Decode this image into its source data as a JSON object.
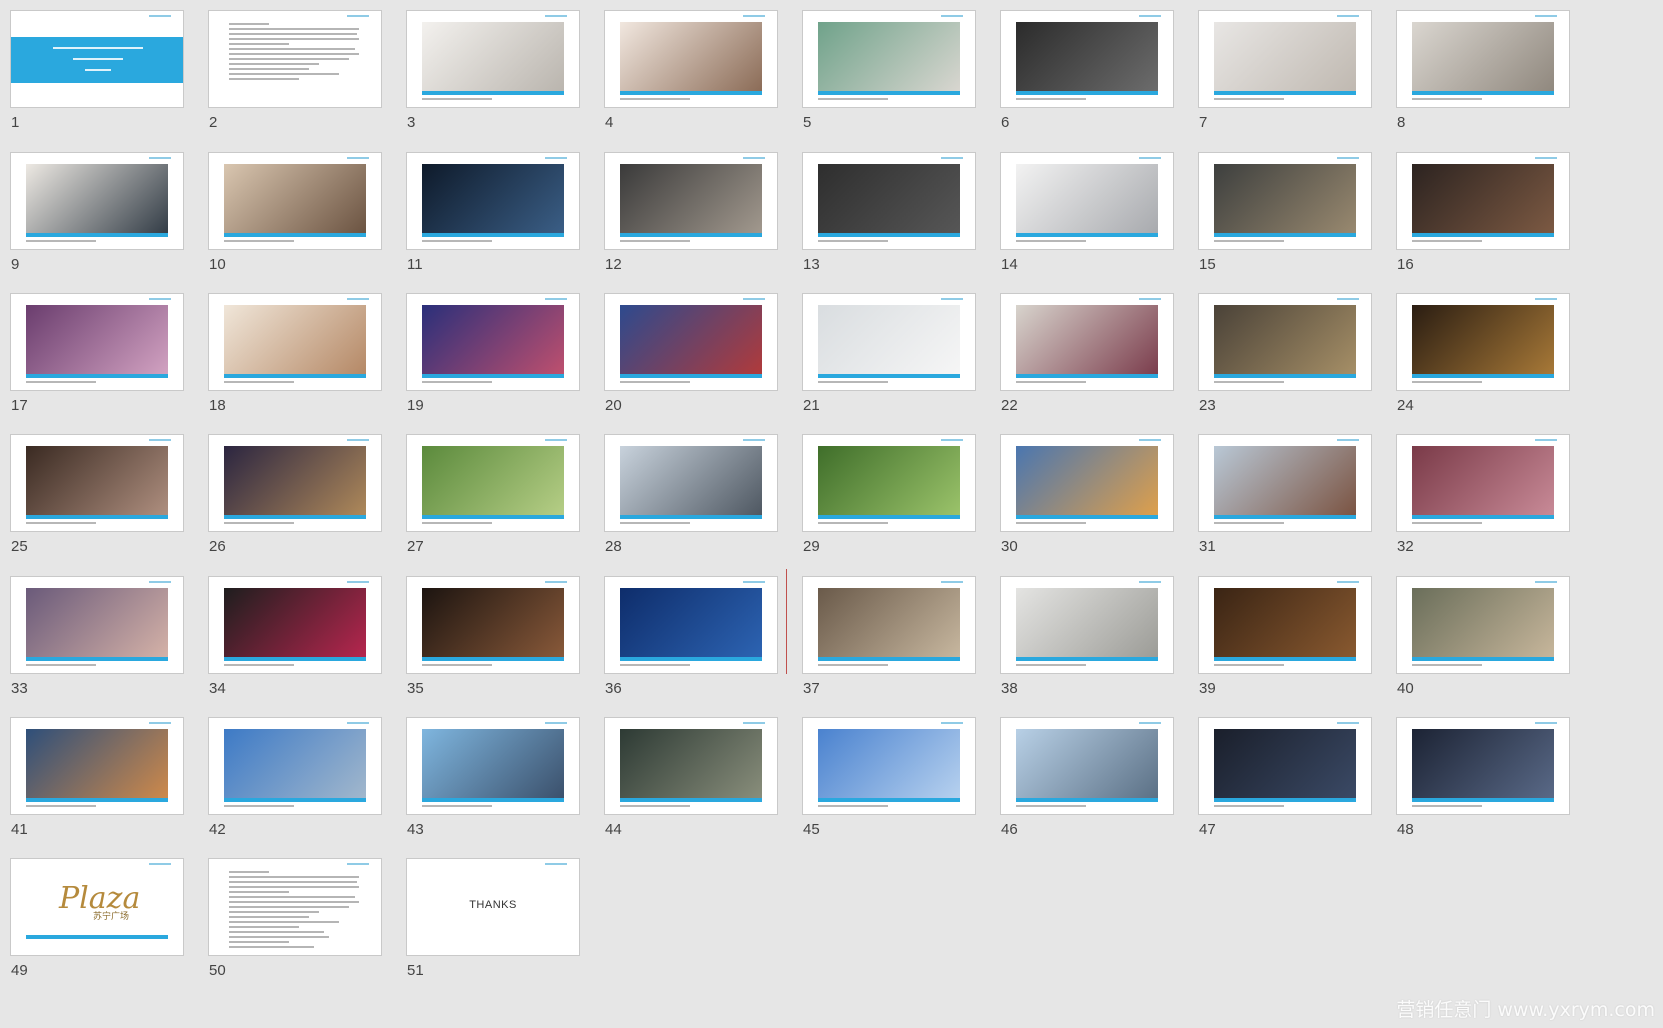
{
  "view": "slide-sorter",
  "slides": [
    {
      "number": "1",
      "kind": "title",
      "photo": [
        "#2aa8de",
        "#2aa8de"
      ]
    },
    {
      "number": "2",
      "kind": "text"
    },
    {
      "number": "3",
      "kind": "photo",
      "photo": [
        "#f3f1ee",
        "#b9b4ad"
      ]
    },
    {
      "number": "4",
      "kind": "photo",
      "photo": [
        "#f1e7df",
        "#8a6a55"
      ]
    },
    {
      "number": "5",
      "kind": "photo",
      "photo": [
        "#6fa28a",
        "#dad7d1"
      ]
    },
    {
      "number": "6",
      "kind": "photo",
      "photo": [
        "#2b2b2b",
        "#6d6d6d"
      ]
    },
    {
      "number": "7",
      "kind": "photo",
      "photo": [
        "#e8e6e4",
        "#bfb8b0"
      ]
    },
    {
      "number": "8",
      "kind": "photo",
      "photo": [
        "#dad6d0",
        "#8f877d"
      ]
    },
    {
      "number": "9",
      "kind": "photo",
      "photo": [
        "#ede9e3",
        "#303a44"
      ]
    },
    {
      "number": "10",
      "kind": "photo",
      "photo": [
        "#d9c6b0",
        "#6a5240"
      ]
    },
    {
      "number": "11",
      "kind": "photo",
      "photo": [
        "#0e1a2a",
        "#3b5f87"
      ]
    },
    {
      "number": "12",
      "kind": "photo",
      "photo": [
        "#3a3a3a",
        "#a39a8f"
      ]
    },
    {
      "number": "13",
      "kind": "photo",
      "photo": [
        "#2e2e2e",
        "#575757"
      ]
    },
    {
      "number": "14",
      "kind": "photo",
      "photo": [
        "#f2f2f2",
        "#a7a9ad"
      ]
    },
    {
      "number": "15",
      "kind": "photo",
      "photo": [
        "#3d3f3e",
        "#9a8a70"
      ]
    },
    {
      "number": "16",
      "kind": "photo",
      "photo": [
        "#2c2320",
        "#7d5a43"
      ]
    },
    {
      "number": "17",
      "kind": "photo",
      "photo": [
        "#6a3d6e",
        "#d3a3c2"
      ]
    },
    {
      "number": "18",
      "kind": "photo",
      "photo": [
        "#f0e6d9",
        "#b48764"
      ]
    },
    {
      "number": "19",
      "kind": "photo",
      "photo": [
        "#2a2f7a",
        "#c0506e"
      ]
    },
    {
      "number": "20",
      "kind": "photo",
      "photo": [
        "#2d4a8e",
        "#b23a3a"
      ]
    },
    {
      "number": "21",
      "kind": "photo",
      "photo": [
        "#d9dde0",
        "#f6f6f6"
      ]
    },
    {
      "number": "22",
      "kind": "photo",
      "photo": [
        "#d8d4cd",
        "#7a3b4b"
      ]
    },
    {
      "number": "23",
      "kind": "photo",
      "photo": [
        "#4a4238",
        "#a79067"
      ]
    },
    {
      "number": "24",
      "kind": "photo",
      "photo": [
        "#2a1d12",
        "#a97a38"
      ]
    },
    {
      "number": "25",
      "kind": "photo",
      "photo": [
        "#3a2a22",
        "#b09080"
      ]
    },
    {
      "number": "26",
      "kind": "photo",
      "photo": [
        "#2b2540",
        "#b08a5a"
      ]
    },
    {
      "number": "27",
      "kind": "photo",
      "photo": [
        "#5b8a3c",
        "#b7cf87"
      ]
    },
    {
      "number": "28",
      "kind": "photo",
      "photo": [
        "#c8d2dc",
        "#4d5660"
      ]
    },
    {
      "number": "29",
      "kind": "photo",
      "photo": [
        "#3f6e2a",
        "#9cc46b"
      ]
    },
    {
      "number": "30",
      "kind": "photo",
      "photo": [
        "#4a76b0",
        "#e0a04a"
      ]
    },
    {
      "number": "31",
      "kind": "photo",
      "photo": [
        "#b9c8d6",
        "#7a5240"
      ]
    },
    {
      "number": "32",
      "kind": "photo",
      "photo": [
        "#7a3a48",
        "#c98b98"
      ]
    },
    {
      "number": "33",
      "kind": "photo",
      "photo": [
        "#6a5a7a",
        "#d6b3a8"
      ]
    },
    {
      "number": "34",
      "kind": "photo",
      "photo": [
        "#1e1e1e",
        "#b8264f"
      ]
    },
    {
      "number": "35",
      "kind": "photo",
      "photo": [
        "#1c1410",
        "#8a5a3a"
      ]
    },
    {
      "number": "36",
      "kind": "photo",
      "photo": [
        "#0e2d6b",
        "#2d64b3"
      ]
    },
    {
      "number": "37",
      "kind": "photo",
      "photo": [
        "#6a5a4a",
        "#c8b8a0"
      ]
    },
    {
      "number": "38",
      "kind": "photo",
      "photo": [
        "#e4e4e2",
        "#9b9b96"
      ]
    },
    {
      "number": "39",
      "kind": "photo",
      "photo": [
        "#3a2414",
        "#8a5a30"
      ]
    },
    {
      "number": "40",
      "kind": "photo",
      "photo": [
        "#6a6e5a",
        "#c8b79c"
      ]
    },
    {
      "number": "41",
      "kind": "photo",
      "photo": [
        "#2e4f7a",
        "#d08a4a"
      ]
    },
    {
      "number": "42",
      "kind": "photo",
      "photo": [
        "#3d7ac6",
        "#a3b8cc"
      ]
    },
    {
      "number": "43",
      "kind": "photo",
      "photo": [
        "#7fb6df",
        "#3a4f6a"
      ]
    },
    {
      "number": "44",
      "kind": "photo",
      "photo": [
        "#2d3a34",
        "#8a8f7c"
      ]
    },
    {
      "number": "45",
      "kind": "photo",
      "photo": [
        "#4a82cf",
        "#b8d2ef"
      ]
    },
    {
      "number": "46",
      "kind": "photo",
      "photo": [
        "#b8d0e6",
        "#5a6f84"
      ]
    },
    {
      "number": "47",
      "kind": "photo",
      "photo": [
        "#1a1f2b",
        "#3b4a66"
      ]
    },
    {
      "number": "48",
      "kind": "photo",
      "photo": [
        "#1c2334",
        "#5a6a88"
      ]
    },
    {
      "number": "49",
      "kind": "logo",
      "logo_script": "Plaza",
      "logo_cn": "苏宁广场"
    },
    {
      "number": "50",
      "kind": "text"
    },
    {
      "number": "51",
      "kind": "thanks",
      "thanks_text": "THANKS"
    }
  ],
  "watermark": "营销任意门 www.yxrym.com"
}
